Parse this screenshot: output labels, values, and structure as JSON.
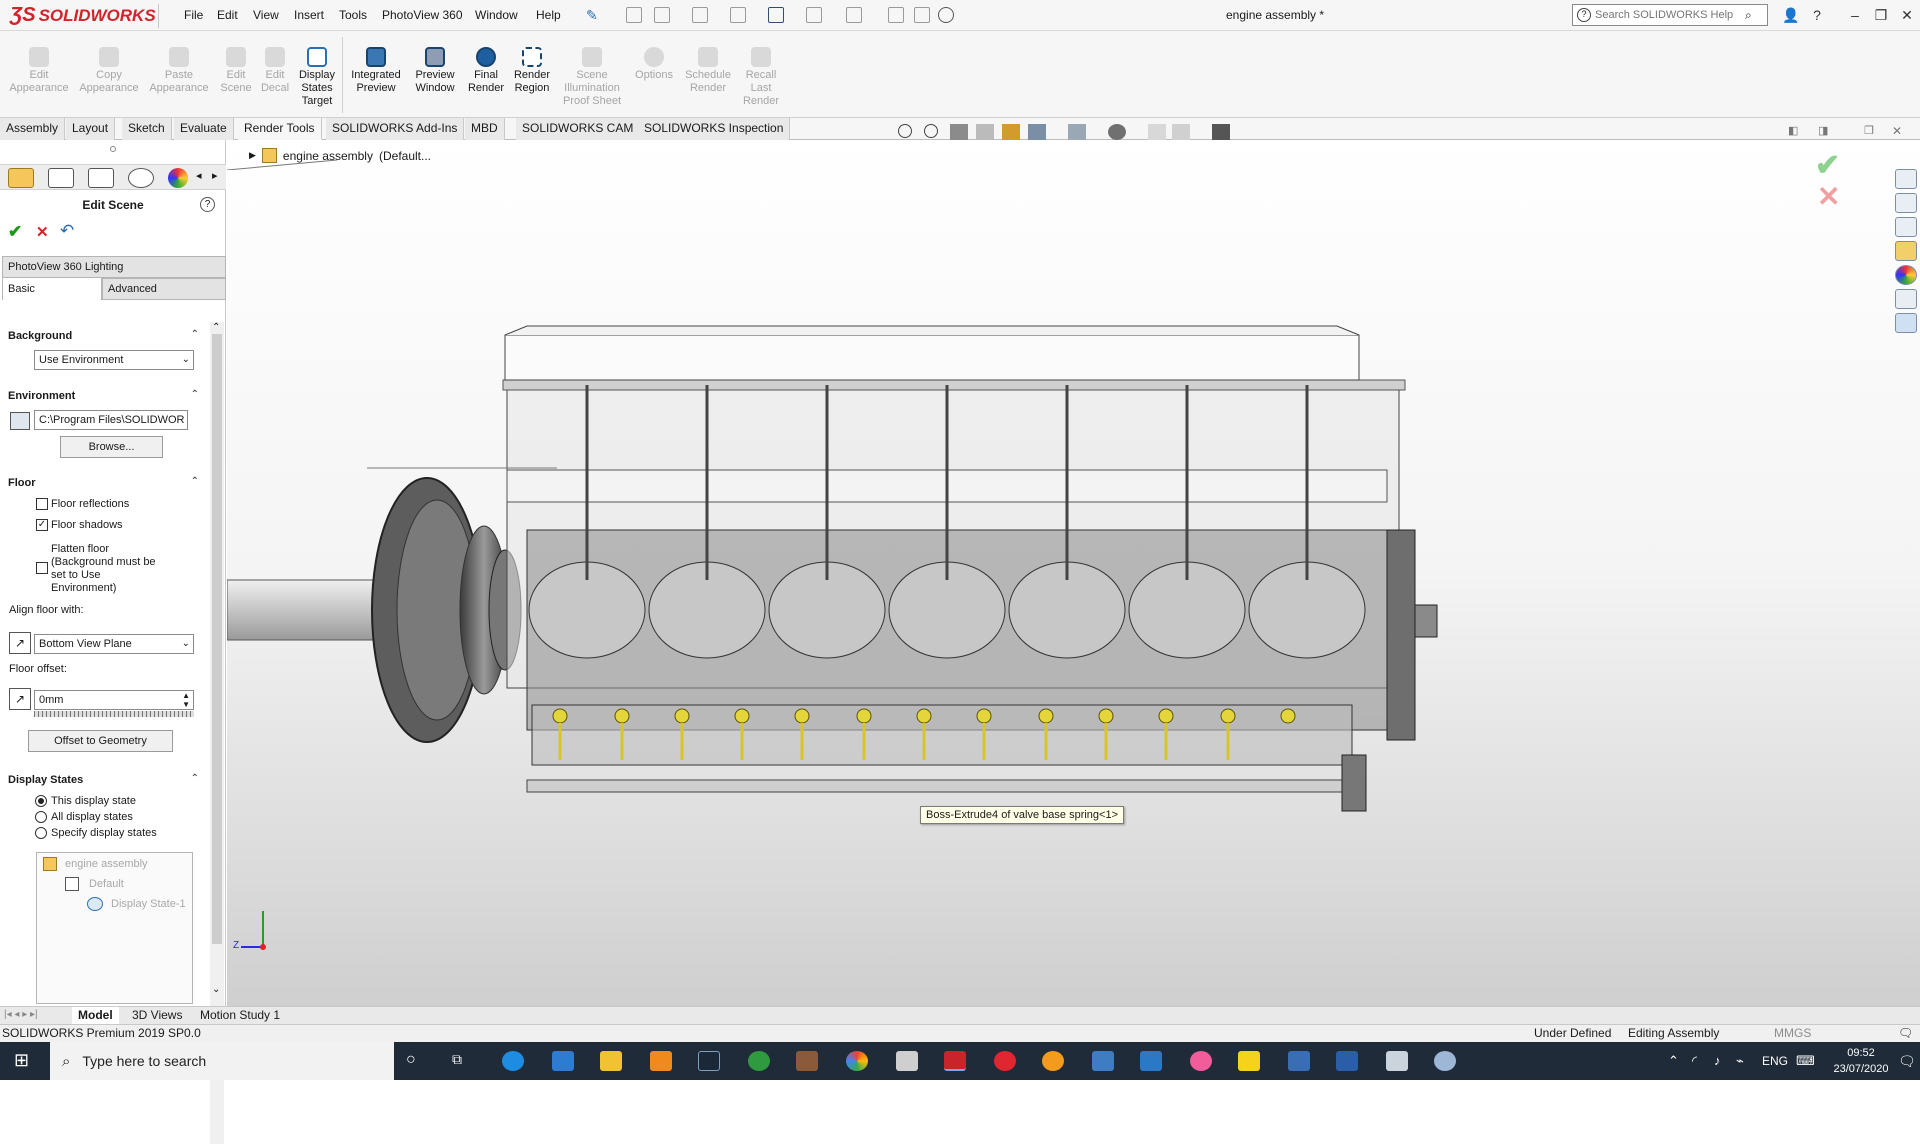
{
  "app": {
    "logo_text": "SOLIDWORKS",
    "document_title": "engine assembly *"
  },
  "menu": [
    "File",
    "Edit",
    "View",
    "Insert",
    "Tools",
    "PhotoView 360",
    "Window",
    "Help"
  ],
  "search": {
    "placeholder": "Search SOLIDWORKS Help"
  },
  "render_tools": [
    {
      "label": "Edit\nAppearance",
      "enabled": false
    },
    {
      "label": "Copy\nAppearance",
      "enabled": false
    },
    {
      "label": "Paste\nAppearance",
      "enabled": false
    },
    {
      "label": "Edit\nScene",
      "enabled": false
    },
    {
      "label": "Edit\nDecal",
      "enabled": false
    },
    {
      "label": "Display\nStates\nTarget",
      "enabled": true
    },
    {
      "label": "Integrated\nPreview",
      "enabled": true
    },
    {
      "label": "Preview\nWindow",
      "enabled": true
    },
    {
      "label": "Final\nRender",
      "enabled": true
    },
    {
      "label": "Render\nRegion",
      "enabled": true
    },
    {
      "label": "Scene\nIllumination\nProof Sheet",
      "enabled": false
    },
    {
      "label": "Options",
      "enabled": false
    },
    {
      "label": "Schedule\nRender",
      "enabled": false
    },
    {
      "label": "Recall\nLast\nRender",
      "enabled": false
    }
  ],
  "command_tabs": [
    "Assembly",
    "Layout",
    "Sketch",
    "Evaluate",
    "Render Tools",
    "SOLIDWORKS Add-Ins",
    "MBD",
    "SOLIDWORKS CAM",
    "SOLIDWORKS Inspection"
  ],
  "active_tab": "Render Tools",
  "property_manager": {
    "title": "Edit Scene",
    "group_title": "PhotoView 360 Lighting",
    "subtabs": [
      "Basic",
      "Advanced"
    ],
    "background": {
      "header": "Background",
      "value": "Use Environment"
    },
    "environment": {
      "header": "Environment",
      "path": "C:\\Program Files\\SOLIDWOR",
      "browse_label": "Browse..."
    },
    "floor": {
      "header": "Floor",
      "floor_reflections": "Floor reflections",
      "floor_reflections_checked": false,
      "floor_shadows": "Floor shadows",
      "floor_shadows_checked": true,
      "flatten_floor": "Flatten floor\n(Background must be\nset to Use\nEnvironment)",
      "flatten_floor_checked": false,
      "align_label": "Align floor with:",
      "align_value": "Bottom View Plane",
      "offset_label": "Floor offset:",
      "offset_value": "0mm",
      "offset_button": "Offset to Geometry"
    },
    "display_states": {
      "header": "Display States",
      "options": [
        "This display state",
        "All display states",
        "Specify display states"
      ],
      "selected": 0,
      "tree_root": "engine assembly",
      "tree_config": "Default",
      "tree_state": "Display State-1"
    }
  },
  "feature_tree": {
    "root": "engine assembly",
    "config": "(Default..."
  },
  "tooltip": "Boss-Extrude4 of valve base spring<1>",
  "triad_label": "Z",
  "bottom_tabs": [
    "Model",
    "3D Views",
    "Motion Study 1"
  ],
  "status": {
    "version": "SOLIDWORKS Premium 2019 SP0.0",
    "defined": "Under Defined",
    "mode": "Editing Assembly",
    "units": "MMGS"
  },
  "taskbar": {
    "search_placeholder": "Type here to search",
    "language": "ENG",
    "time": "09:52",
    "date": "23/07/2020"
  },
  "colors": {
    "brand": "#d2232a",
    "taskbar": "#1f2b38",
    "accent": "#3b77b5"
  }
}
